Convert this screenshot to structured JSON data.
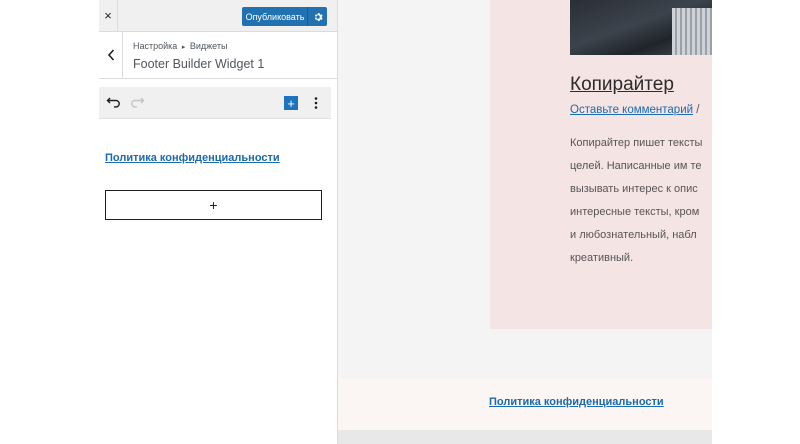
{
  "topbar": {
    "close_symbol": "×",
    "publish_label": "Опубликовать",
    "settings_icon": "gear-icon"
  },
  "section": {
    "breadcrumb_root": "Настройка",
    "breadcrumb_separator": "▸",
    "breadcrumb_child": "Виджеты",
    "title": "Footer Builder Widget 1"
  },
  "toolbar": {
    "undo_icon": "undo-icon",
    "redo_icon": "redo-icon",
    "add_symbol": "+",
    "more_icon": "more-vertical-icon"
  },
  "widget": {
    "link_text": "Политика конфиденциальности",
    "add_block_symbol": "+"
  },
  "preview": {
    "post": {
      "title": "Копирайтер",
      "comment_link": "Оставьте комментарий",
      "meta_separator": "/",
      "excerpt_lines": [
        "Копирайтер пишет тексты",
        "целей. Написанные им те",
        "вызывать интерес к опис",
        "интересные тексты, кром",
        "и любознательный, набл",
        "креативный."
      ]
    },
    "footer_link": "Политика конфиденциальности"
  },
  "colors": {
    "accent": "#2271b1",
    "link": "#1b6bad",
    "card_bg": "#f5e4e4",
    "footer_bg": "#fbf5f4"
  }
}
